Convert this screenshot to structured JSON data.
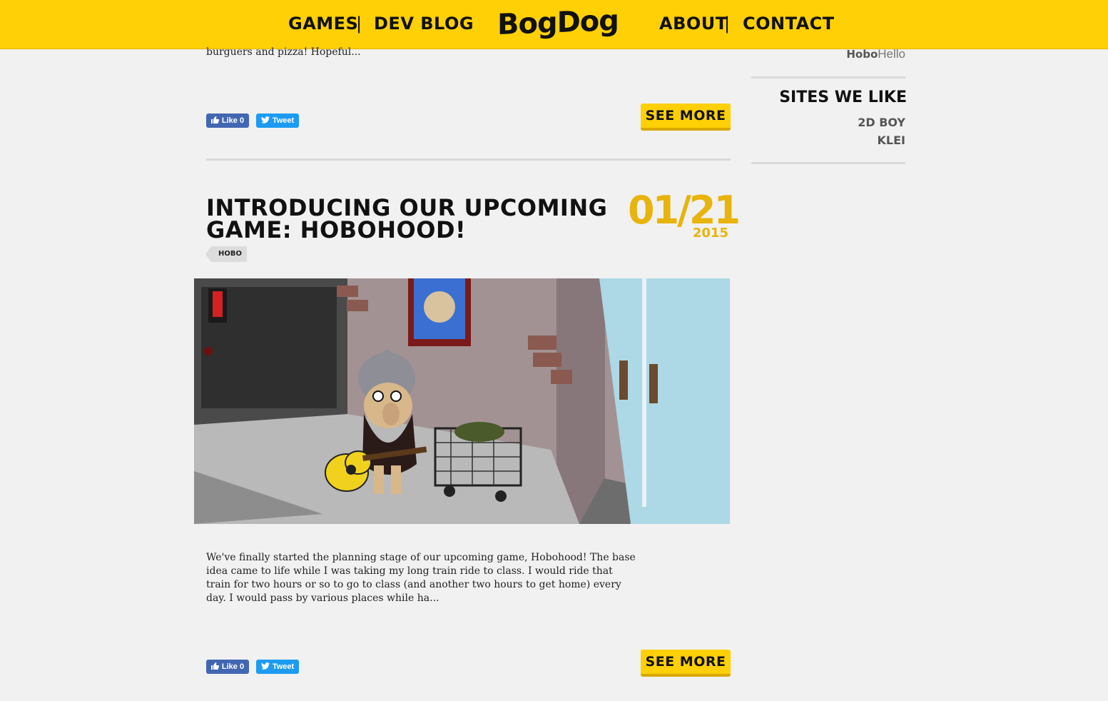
{
  "header": {
    "nav_left": [
      "Games",
      "Dev Blog"
    ],
    "logo": "BogDog",
    "nav_right": [
      "About",
      "Contact"
    ],
    "separator": "|"
  },
  "previous_post": {
    "excerpt_tail": "burguers and pizza! Hopeful...",
    "like_label": "Like 0",
    "tweet_label": "Tweet",
    "see_more": "See More"
  },
  "post": {
    "title": "Introducing our upcoming game: Hobohood!",
    "date": "01/21",
    "year": "2015",
    "tag": "Hobo",
    "excerpt": "We've finally started the planning stage of our upcoming game, Hobohood! The base idea came to life while I was taking my long train ride to class. I would ride that train for two hours or so to go to class (and another two hours to get home) every day. I would pass by various places while ha...",
    "like_label": "Like 0",
    "tweet_label": "Tweet",
    "see_more": "See More"
  },
  "sidebar": {
    "hobo_tag": "Hobo",
    "hello": "Hello",
    "sites_heading": "Sites we like",
    "sites": [
      "2D Boy",
      "Klei"
    ]
  },
  "colors": {
    "brand_yellow": "#fed005",
    "date_gold": "#e8b40c",
    "facebook": "#4267b2",
    "twitter": "#1d9bf0"
  }
}
